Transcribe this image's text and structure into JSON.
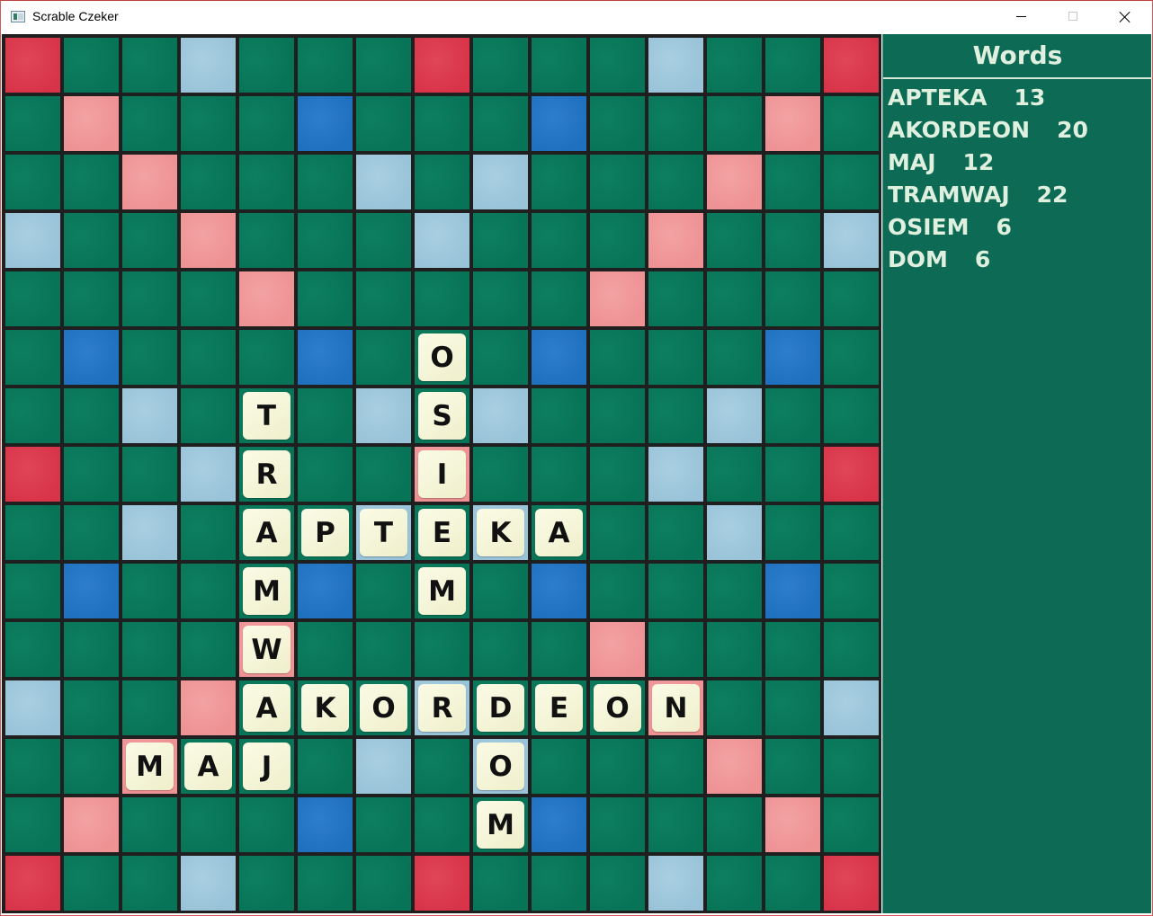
{
  "window": {
    "title": "Scrable Czeker",
    "icon": "app-icon",
    "controls": [
      "minimize-icon",
      "maximize-icon",
      "close-icon"
    ]
  },
  "colors": {
    "board_cell": "#087457",
    "triple_word": "#d83449",
    "double_word": "#ee9294",
    "triple_letter": "#1f70bf",
    "double_letter": "#99c3d8",
    "tile": "#f4f4d6",
    "panel": "#0d6b55"
  },
  "board": {
    "size": 15,
    "premium_rows": [
      "T..d...T...d..T",
      ".D...t...t...D.",
      "..D...d.d...D..",
      "d..D...d...D..d",
      "....D.....D....",
      ".t...t...t...t.",
      "..d...d.d...d..",
      "T..d...D...d..T",
      "..d...d.d...d..",
      ".t...t...t...t.",
      "....D.....D....",
      "d..D...d...D..d",
      "..D...d.d...D..",
      ".D...t...t...D.",
      "T..d...T...d..T"
    ],
    "tiles": [
      {
        "row": 5,
        "col": 7,
        "letter": "O"
      },
      {
        "row": 6,
        "col": 4,
        "letter": "T"
      },
      {
        "row": 6,
        "col": 7,
        "letter": "S"
      },
      {
        "row": 7,
        "col": 4,
        "letter": "R"
      },
      {
        "row": 7,
        "col": 7,
        "letter": "I"
      },
      {
        "row": 8,
        "col": 4,
        "letter": "A"
      },
      {
        "row": 8,
        "col": 5,
        "letter": "P"
      },
      {
        "row": 8,
        "col": 6,
        "letter": "T"
      },
      {
        "row": 8,
        "col": 7,
        "letter": "E"
      },
      {
        "row": 8,
        "col": 8,
        "letter": "K"
      },
      {
        "row": 8,
        "col": 9,
        "letter": "A"
      },
      {
        "row": 9,
        "col": 4,
        "letter": "M"
      },
      {
        "row": 9,
        "col": 7,
        "letter": "M"
      },
      {
        "row": 10,
        "col": 4,
        "letter": "W"
      },
      {
        "row": 11,
        "col": 4,
        "letter": "A"
      },
      {
        "row": 11,
        "col": 5,
        "letter": "K"
      },
      {
        "row": 11,
        "col": 6,
        "letter": "O"
      },
      {
        "row": 11,
        "col": 7,
        "letter": "R"
      },
      {
        "row": 11,
        "col": 8,
        "letter": "D"
      },
      {
        "row": 11,
        "col": 9,
        "letter": "E"
      },
      {
        "row": 11,
        "col": 10,
        "letter": "O"
      },
      {
        "row": 11,
        "col": 11,
        "letter": "N"
      },
      {
        "row": 12,
        "col": 2,
        "letter": "M"
      },
      {
        "row": 12,
        "col": 3,
        "letter": "A"
      },
      {
        "row": 12,
        "col": 4,
        "letter": "J"
      },
      {
        "row": 12,
        "col": 8,
        "letter": "O"
      },
      {
        "row": 13,
        "col": 8,
        "letter": "M"
      }
    ]
  },
  "words_panel": {
    "title": "Words",
    "words": [
      {
        "word": "APTEKA",
        "score": "13"
      },
      {
        "word": "AKORDEON",
        "score": "20"
      },
      {
        "word": "MAJ",
        "score": "12"
      },
      {
        "word": "TRAMWAJ",
        "score": "22"
      },
      {
        "word": "OSIEM",
        "score": "6"
      },
      {
        "word": "DOM",
        "score": "6"
      }
    ]
  }
}
